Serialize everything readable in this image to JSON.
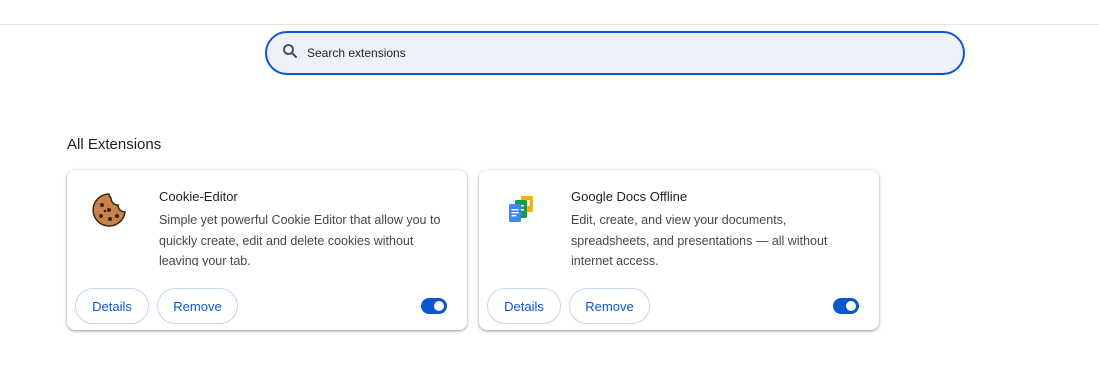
{
  "search": {
    "placeholder": "Search extensions",
    "value": ""
  },
  "section_title": "All Extensions",
  "extensions": [
    {
      "name": "Cookie-Editor",
      "description": "Simple yet powerful Cookie Editor that allow you to quickly create, edit and delete cookies without leaving your tab.",
      "icon": "cookie-icon",
      "details_label": "Details",
      "remove_label": "Remove",
      "enabled": true
    },
    {
      "name": "Google Docs Offline",
      "description": "Edit, create, and view your documents, spreadsheets, and presentations — all without internet access.",
      "icon": "google-docs-offline-icon",
      "details_label": "Details",
      "remove_label": "Remove",
      "enabled": true
    }
  ],
  "colors": {
    "accent": "#0b57d0",
    "search_bg": "#eef1f7"
  }
}
